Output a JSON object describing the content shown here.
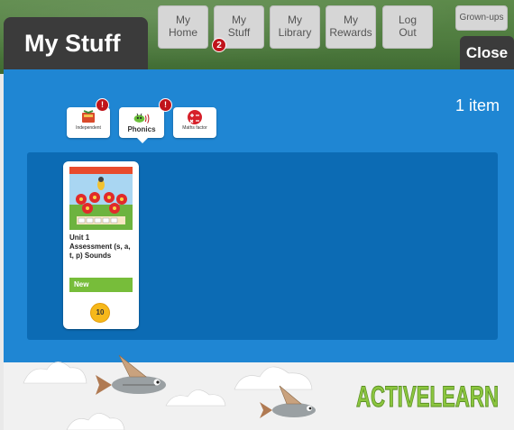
{
  "header": {
    "title": "My Stuff",
    "nav": [
      {
        "line1": "My",
        "line2": "Home"
      },
      {
        "line1": "My",
        "line2": "Stuff",
        "badge": "2"
      },
      {
        "line1": "My",
        "line2": "Library"
      },
      {
        "line1": "My",
        "line2": "Rewards"
      },
      {
        "line1": "Log",
        "line2": "Out"
      }
    ],
    "grownups_label": "Grown-ups",
    "close_label": "Close"
  },
  "main": {
    "item_count": "1 item",
    "filters": [
      {
        "label": "Independent",
        "icon": "book-icon",
        "badge": "!"
      },
      {
        "label": "Phonics",
        "icon": "bee-icon",
        "badge": "!"
      },
      {
        "label": "Maths factor",
        "icon": "maths-symbols-icon"
      }
    ],
    "cards": [
      {
        "title": "Unit 1 Assessment (s, a, t, p) Sounds",
        "status": "New",
        "points": "10"
      }
    ]
  },
  "footer": {
    "logo_text": "ACTIVELEARN"
  },
  "colors": {
    "header_bg": "#4f7c3f",
    "title_tab": "#3b3b3b",
    "main_bg": "#1f86d3",
    "shelf_bg": "#0c6bb4",
    "new_badge": "#77bd3a",
    "points_coin": "#f6b81a",
    "notification": "#c0141b",
    "logo_green": "#8cc63f"
  }
}
